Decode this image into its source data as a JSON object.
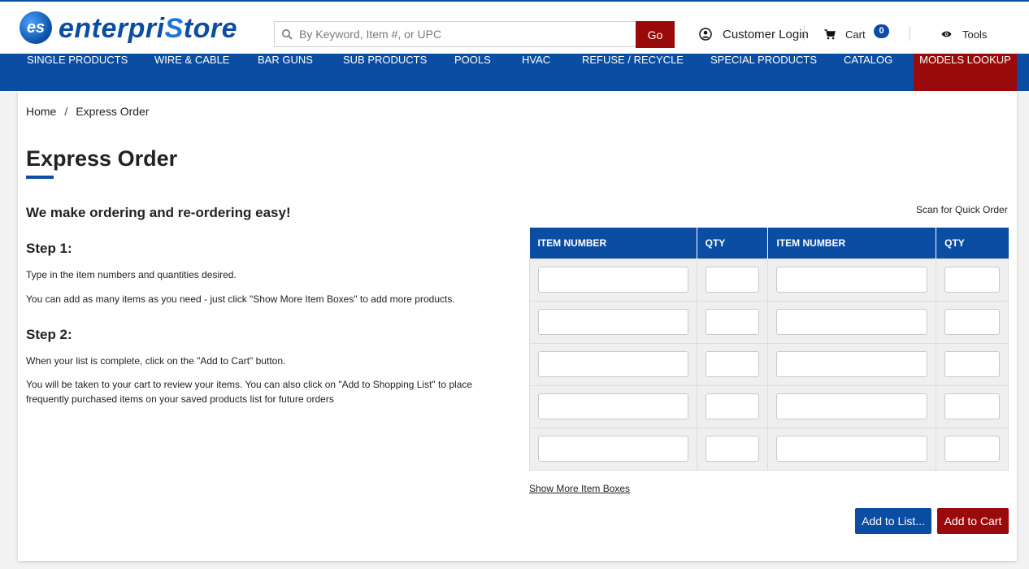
{
  "brand": {
    "logo_mark": "es",
    "name_part1": "enterpri",
    "name_part2": "S",
    "name_part3": "tore"
  },
  "search": {
    "placeholder": "By Keyword, Item #, or UPC",
    "go_label": "Go"
  },
  "header": {
    "login_label": "Customer Login",
    "cart_label": "Cart",
    "cart_count": "0",
    "tools_label": "Tools"
  },
  "nav": {
    "items": [
      "SINGLE PRODUCTS",
      "WIRE & CABLE",
      "BAR GUNS",
      "SUB PRODUCTS",
      "POOLS",
      "HVAC",
      "REFUSE / RECYCLE",
      "SPECIAL PRODUCTS",
      "CATALOG",
      "MODELS LOOKUP"
    ]
  },
  "breadcrumb": {
    "home": "Home",
    "separator": "/",
    "current": "Express Order"
  },
  "page": {
    "title": "Express Order",
    "intro": "We make ordering and re-ordering easy!",
    "step1_title": "Step 1:",
    "step1_p1": "Type in the item numbers and quantities desired.",
    "step1_p2": "You can add as many items as you need - just click \"Show More Item Boxes\" to add more products.",
    "step2_title": "Step 2:",
    "step2_p1": "When your list is complete, click on the \"Add to Cart\" button.",
    "step2_p2": "You will be taken to your cart to review your items. You can also click on \"Add to Shopping List\" to place frequently purchased items on your saved products list for future orders"
  },
  "order": {
    "scan_label": "Scan for Quick Order",
    "headers": [
      "ITEM NUMBER",
      "QTY",
      "ITEM NUMBER",
      "QTY"
    ],
    "rows": [
      [
        "",
        "",
        "",
        ""
      ],
      [
        "",
        "",
        "",
        ""
      ],
      [
        "",
        "",
        "",
        ""
      ],
      [
        "",
        "",
        "",
        ""
      ],
      [
        "",
        "",
        "",
        ""
      ]
    ],
    "show_more_label": "Show More Item Boxes",
    "add_to_list_label": "Add to List...",
    "add_to_cart_label": "Add to Cart"
  },
  "colors": {
    "primary": "#0b4da2",
    "accent": "#9b0a0a",
    "cell_bg": "#efefef"
  }
}
